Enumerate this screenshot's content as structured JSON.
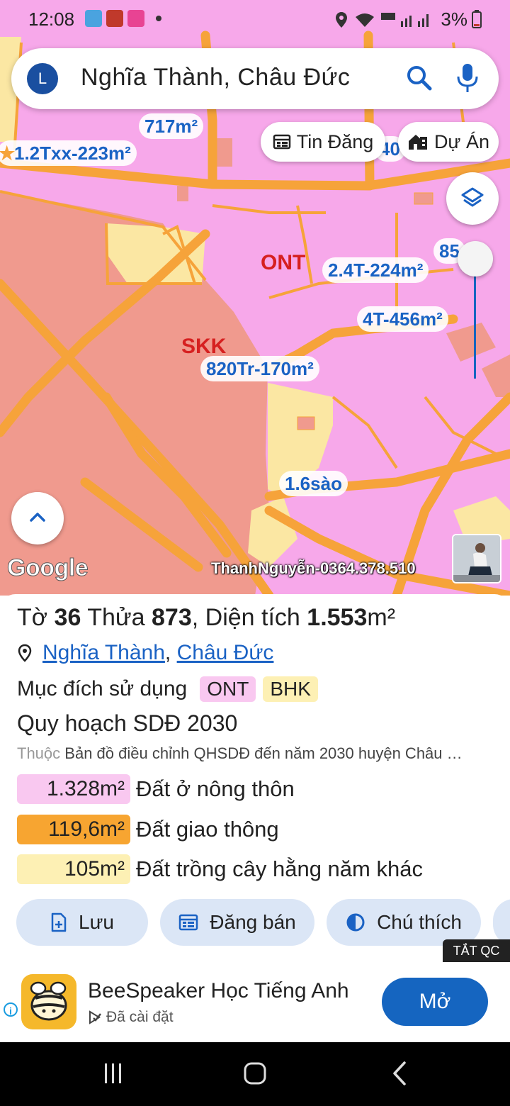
{
  "status_bar": {
    "time": "12:08",
    "battery": "3%"
  },
  "search": {
    "avatar_letter": "L",
    "query": "Nghĩa Thành, Châu Đức"
  },
  "chips": {
    "listings": "Tin Đăng",
    "projects": "Dự Án"
  },
  "map": {
    "parcel_labels": [
      "717m²",
      "1.2Txx-223m²",
      "2.4T-224m²",
      "4T-456m²",
      "820Tr-170m²",
      "1.6sào",
      "85",
      "40"
    ],
    "zone_labels": [
      "ONT",
      "SKK"
    ],
    "attribution": "Google",
    "watermark": "ThanhNguyễn-0364.378.510"
  },
  "parcel": {
    "sheet_prefix": "Tờ",
    "sheet_no": "36",
    "plot_prefix": "Thửa",
    "plot_no": "873",
    "area_prefix": ", Diện tích",
    "area_value": "1.553",
    "area_unit": "m²",
    "commune": "Nghĩa Thành",
    "separator": ",",
    "district": "Châu Đức",
    "purpose_label": "Mục đích sử dụng",
    "purpose_tags": [
      "ONT",
      "BHK"
    ],
    "plan_title": "Quy hoạch SDĐ 2030",
    "belongs_prefix": "Thuộc",
    "belongs_text": "Bản đồ điều chỉnh QHSDĐ đến năm 2030 huyện Châu …",
    "areas": [
      {
        "value": "1.328m²",
        "name": "Đất ở nông thôn",
        "color": "#f9c8f0"
      },
      {
        "value": "119,6m²",
        "name": "Đất giao thông",
        "color": "#f7a531"
      },
      {
        "value": "105m²",
        "name": "Đất trồng cây hằng năm khác",
        "color": "#fdf0b4"
      }
    ]
  },
  "actions": {
    "save": "Lưu",
    "post_sale": "Đăng bán",
    "legend": "Chú thích"
  },
  "ad": {
    "close_ads": "TẮT QC",
    "app_name": "BeeSpeaker Học Tiếng Anh",
    "installed": "Đã cài đặt",
    "open": "Mở"
  },
  "colors": {
    "accent": "#1565c0",
    "residential_zone": "#f7a8ea",
    "industrial_zone": "#f09a8e",
    "road": "#f6a33a",
    "annual_crop_zone": "#fbe7a3",
    "label_text": "#1a62c4"
  }
}
